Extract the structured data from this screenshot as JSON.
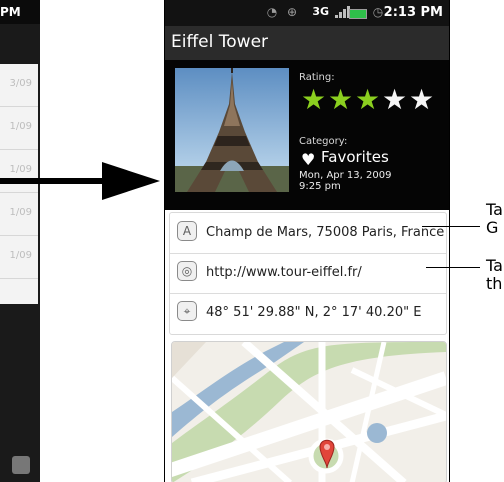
{
  "left_phone": {
    "status_time": "PM",
    "dates": [
      "3/09",
      "1/09",
      "1/09",
      "1/09",
      "1/09"
    ]
  },
  "status_bar": {
    "network": "3G",
    "time": "2:13 PM"
  },
  "title": "Eiffel Tower",
  "details": {
    "rating_label": "Rating:",
    "rating_value": 3,
    "rating_max": 5,
    "category_label": "Category:",
    "category_value": "Favorites",
    "date_line1": "Mon, Apr 13, 2009",
    "date_line2": "9:25 pm"
  },
  "info": {
    "address": "Champ de Mars, 75008 Paris, France",
    "website": "http://www.tour-eiffel.fr/",
    "coordinates": "48° 51' 29.88\" N, 2° 17' 40.20\" E"
  },
  "callouts": {
    "one_a": "Ta",
    "one_b": "G",
    "two_a": "Ta",
    "two_b": "th"
  },
  "colors": {
    "star_filled": "#8bcf1f",
    "star_empty": "#f6f6f6",
    "battery": "#2fbf4a",
    "map_water": "#9bb8d3",
    "map_green": "#c7dbb0",
    "map_road": "#ffffff"
  }
}
